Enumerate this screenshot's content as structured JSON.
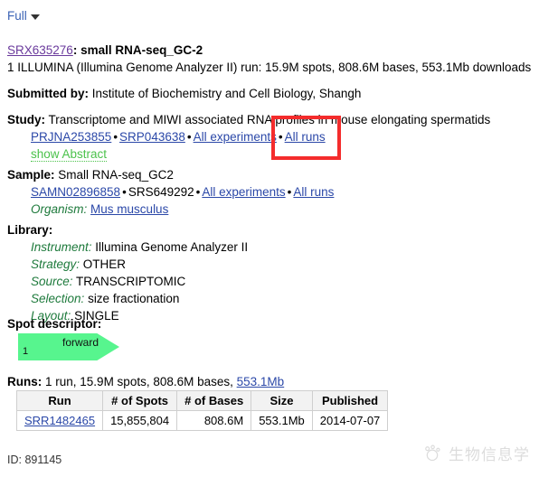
{
  "display_mode": {
    "label": "Full",
    "caret_icon": "chevron-down-icon"
  },
  "record": {
    "accession": "SRX635276",
    "title_sep": ": ",
    "title": "small RNA-seq_GC-2",
    "summary": "1 ILLUMINA (Illumina Genome Analyzer II) run: 15.9M spots, 808.6M bases, 553.1Mb downloads",
    "submitted_by_label": "Submitted by:",
    "submitted_by_value": "Institute of Biochemistry and Cell Biology, Shangh",
    "study": {
      "label": "Study:",
      "title": "Transcriptome and MIWI associated RNA profiles in mouse elongating spermatids",
      "bioproject": "PRJNA253855",
      "srp": "SRP043638",
      "all_experiments": "All experiments",
      "all_runs": "All runs",
      "show_abstract": "show Abstract"
    },
    "sample": {
      "label": "Sample:",
      "title": "Small RNA-seq_GC2",
      "biosample": "SAMN02896858",
      "srs": "SRS649292",
      "all_experiments": "All experiments",
      "all_runs": "All runs",
      "organism_label": "Organism:",
      "organism_value": "Mus musculus"
    },
    "library": {
      "label": "Library:",
      "fields": [
        {
          "name": "Instrument:",
          "value": "Illumina Genome Analyzer II"
        },
        {
          "name": "Strategy:",
          "value": "OTHER"
        },
        {
          "name": "Source:",
          "value": "TRANSCRIPTOMIC"
        },
        {
          "name": "Selection:",
          "value": "size fractionation"
        },
        {
          "name": "Layout:",
          "value": "SINGLE"
        }
      ]
    },
    "spot_descriptor": {
      "label": "Spot descriptor:",
      "read_label": "forward",
      "read_index": "1",
      "color": "#57f58e"
    },
    "runs": {
      "label": "Runs:",
      "summary_prefix": "1 run, 15.9M spots, 808.6M bases, ",
      "size_link": "553.1Mb",
      "columns": [
        "Run",
        "# of Spots",
        "# of Bases",
        "Size",
        "Published"
      ],
      "rows": [
        {
          "run": "SRR1482465",
          "spots": "15,855,804",
          "bases": "808.6M",
          "size": "553.1Mb",
          "published": "2014-07-07"
        }
      ]
    },
    "id_line": "ID: 891145"
  },
  "annotation": {
    "highlight_target": "All runs",
    "highlight_color": "#f42c2c"
  },
  "watermark": {
    "text": "生物信息学",
    "logo_icon": "paw-circle-icon"
  },
  "colors": {
    "link": "#2b48a8",
    "visited_link": "#6a3a9c",
    "field_label": "#1e7a3c",
    "green_link": "#4bc24b",
    "table_header_bg": "#f2f2f2",
    "table_border": "#cfcfcf"
  }
}
